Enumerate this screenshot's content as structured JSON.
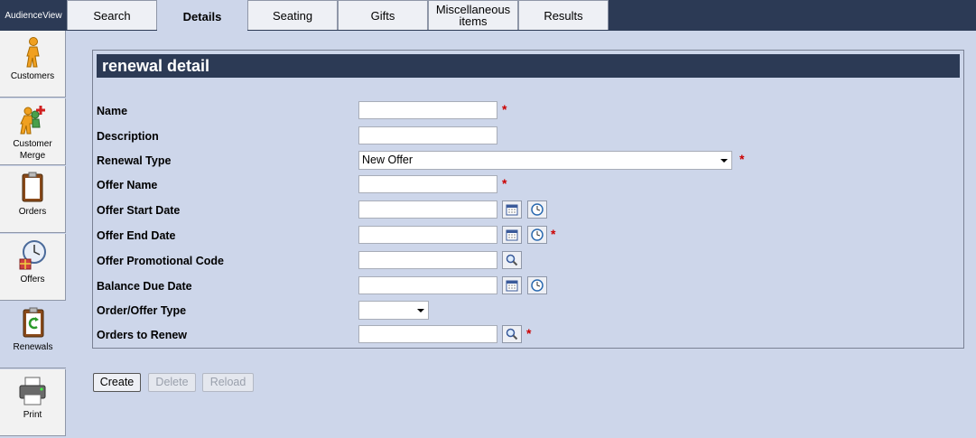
{
  "app": {
    "brand": "AudienceView"
  },
  "tabs": [
    {
      "label": "Search"
    },
    {
      "label": "Details",
      "active": true
    },
    {
      "label": "Seating"
    },
    {
      "label": "Gifts"
    },
    {
      "label": "Miscellaneous items"
    },
    {
      "label": "Results"
    }
  ],
  "sidebar": {
    "items": [
      {
        "label": "Customers",
        "icon": "person-walking-icon"
      },
      {
        "label": "Customer Merge",
        "icon": "customer-merge-icon"
      },
      {
        "label": "Orders",
        "icon": "clipboard-icon"
      },
      {
        "label": "Offers",
        "icon": "clock-gift-icon"
      },
      {
        "label": "Renewals",
        "icon": "renewal-clipboard-icon",
        "active": true
      },
      {
        "label": "Print",
        "icon": "printer-icon"
      }
    ]
  },
  "panel": {
    "title": "renewal detail",
    "fields": {
      "name": {
        "label": "Name",
        "value": "",
        "required": true
      },
      "description": {
        "label": "Description",
        "value": ""
      },
      "renewal_type": {
        "label": "Renewal Type",
        "value": "New Offer",
        "required": true
      },
      "offer_name": {
        "label": "Offer Name",
        "value": "",
        "required": true
      },
      "offer_start_date": {
        "label": "Offer Start Date",
        "value": ""
      },
      "offer_end_date": {
        "label": "Offer End Date",
        "value": "",
        "required": true
      },
      "offer_promotional_code": {
        "label": "Offer Promotional Code",
        "value": ""
      },
      "balance_due_date": {
        "label": "Balance Due Date",
        "value": ""
      },
      "order_offer_type": {
        "label": "Order/Offer Type",
        "value": ""
      },
      "orders_to_renew": {
        "label": "Orders to Renew",
        "value": "",
        "required": true
      }
    },
    "required_mark": "*"
  },
  "actions": {
    "create": "Create",
    "delete": "Delete",
    "reload": "Reload"
  },
  "colors": {
    "header_bg": "#2c3a55",
    "page_bg": "#cdd6ea",
    "required": "#cc0000"
  }
}
